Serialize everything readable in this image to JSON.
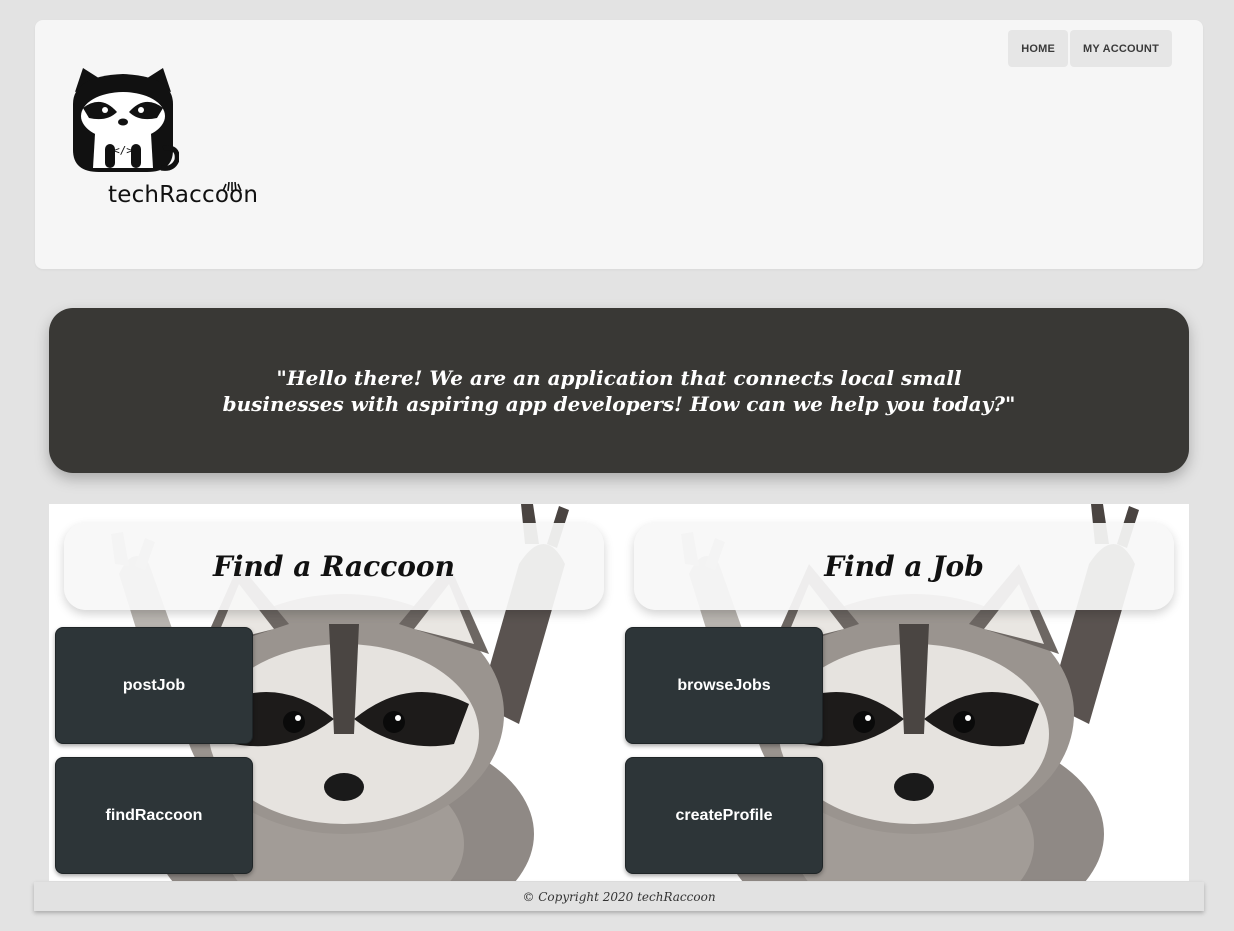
{
  "header": {
    "brand_name": "techRaccoon",
    "nav": [
      {
        "label": "HOME"
      },
      {
        "label": "MY ACCOUNT"
      }
    ]
  },
  "hero": {
    "quote": "\"Hello there! We are an application that connects local small businesses with aspiring app developers! How can we help you today?\""
  },
  "sections": [
    {
      "title": "Find a Raccoon",
      "buttons": [
        {
          "label": "postJob"
        },
        {
          "label": "findRaccoon"
        }
      ]
    },
    {
      "title": "Find a Job",
      "buttons": [
        {
          "label": "browseJobs"
        },
        {
          "label": "createProfile"
        }
      ]
    }
  ],
  "footer": {
    "copyright": "© Copyright 2020 techRaccoon"
  },
  "colors": {
    "page_bg": "#e3e3e3",
    "hero_bg": "#393835",
    "button_bg": "#2d3538"
  }
}
